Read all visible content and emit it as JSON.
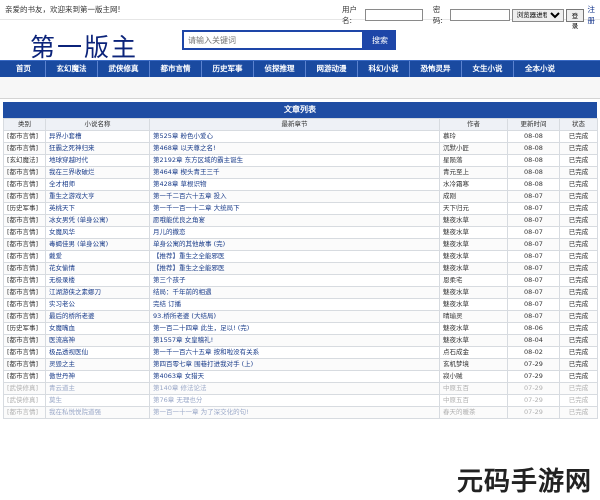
{
  "topbar": {
    "welcome": "亲爱的书友，欢迎来到第一版主网!",
    "username_label": "用户名:",
    "password_label": "密码:",
    "remember_option": "浏览器进程",
    "login_button": "登录",
    "register_link": "注册"
  },
  "header": {
    "logo": "第一版主",
    "search_placeholder": "请输入关键词",
    "search_button": "搜索"
  },
  "nav": {
    "items": [
      "首页",
      "玄幻魔法",
      "武侠修真",
      "都市言情",
      "历史军事",
      "侦探推理",
      "网游动漫",
      "科幻小说",
      "恐怖灵异",
      "女生小说",
      "全本小说"
    ]
  },
  "list": {
    "title": "文章列表",
    "columns": [
      "类别",
      "小说名称",
      "最新章节",
      "作者",
      "更新时间",
      "状态"
    ],
    "rows": [
      {
        "cat": "[都市言情]",
        "book": "异界小套槽",
        "chapter": "第525章 粉色小爱心",
        "author": "慕玲",
        "time": "08-08",
        "status": "已完成"
      },
      {
        "cat": "[都市言情]",
        "book": "狂霸之死神归来",
        "chapter": "第468章 以天尊之名!",
        "author": "沉默小匠",
        "time": "08-08",
        "status": "已完成"
      },
      {
        "cat": "[玄幻魔法]",
        "book": "地球穿越时代",
        "chapter": "第2192章 东方区域的霸主诞生",
        "author": "星陨落",
        "time": "08-08",
        "status": "已完成"
      },
      {
        "cat": "[都市言情]",
        "book": "我在三界收破烂",
        "chapter": "第464章 楔头青王三千",
        "author": "青元至上",
        "time": "08-08",
        "status": "已完成"
      },
      {
        "cat": "[都市言情]",
        "book": "全才相师",
        "chapter": "第428章 草根识物",
        "author": "水冷霜寒",
        "time": "08-08",
        "status": "已完成"
      },
      {
        "cat": "[都市言情]",
        "book": "重生之游戏大亨",
        "chapter": "第一千二百六十五章 投入",
        "author": "成刚",
        "time": "08-07",
        "status": "已完成"
      },
      {
        "cat": "[历史军事]",
        "book": "英桃天下",
        "chapter": "第一千一百一十二章 大统局下",
        "author": "天下归元",
        "time": "08-07",
        "status": "已完成"
      },
      {
        "cat": "[都市言情]",
        "book": "冰女男凭 (单身公寓)",
        "chapter": "愿哦能优良之角宴",
        "author": "魅夜水草",
        "time": "08-07",
        "status": "已完成"
      },
      {
        "cat": "[都市言情]",
        "book": "女魔风华",
        "chapter": "月儿的撒恋",
        "author": "魅夜水草",
        "time": "08-07",
        "status": "已完成"
      },
      {
        "cat": "[都市言情]",
        "book": "毒蝎佳男 (单身公寓)",
        "chapter": "单身公寓的其他故事 (完)",
        "author": "魅夜水草",
        "time": "08-07",
        "status": "已完成"
      },
      {
        "cat": "[都市言情]",
        "book": "戴爱",
        "chapter": "【推荐】重生之全能邪医",
        "author": "魅夜水草",
        "time": "08-07",
        "status": "已完成"
      },
      {
        "cat": "[都市言情]",
        "book": "花女偷情",
        "chapter": "【推荐】重生之全能邪医",
        "author": "魅夜水草",
        "time": "08-07",
        "status": "已完成"
      },
      {
        "cat": "[都市言情]",
        "book": "无极录楼",
        "chapter": "第三个孩子",
        "author": "恩柔宅",
        "time": "08-07",
        "status": "已完成"
      },
      {
        "cat": "[都市言情]",
        "book": "江湖游侠之素娜刀",
        "chapter": "结局：千年前的相遇",
        "author": "魅夜水草",
        "time": "08-07",
        "status": "已完成"
      },
      {
        "cat": "[都市言情]",
        "book": "实习老公",
        "chapter": "完结 订播",
        "author": "魅夜水草",
        "time": "08-07",
        "status": "已完成"
      },
      {
        "cat": "[都市言情]",
        "book": "最后的桥所老婆",
        "chapter": "93.桥所老婆 (大结局)",
        "author": "晴瑜灵",
        "time": "08-07",
        "status": "已完成"
      },
      {
        "cat": "[历史军事]",
        "book": "女魔嘴血",
        "chapter": "第一百二十四章 此生，足以! (完)",
        "author": "魅夜水草",
        "time": "08-06",
        "status": "已完成"
      },
      {
        "cat": "[都市言情]",
        "book": "医流高神",
        "chapter": "第1557章 女皇稽礼!",
        "author": "魅夜水草",
        "time": "08-04",
        "status": "已完成"
      },
      {
        "cat": "[都市言情]",
        "book": "极品透视医仙",
        "chapter": "第一千一百六十五章 按和啦没有关系",
        "author": "点石成金",
        "time": "08-02",
        "status": "已完成"
      },
      {
        "cat": "[都市言情]",
        "book": "灵毁之主",
        "chapter": "第四百零七章 围巷打进我对手 (上)",
        "author": "玄机梦境",
        "time": "07-29",
        "status": "已完成"
      },
      {
        "cat": "[都市言情]",
        "book": "傲世丹神",
        "chapter": "第4063章 女猎天",
        "author": "寂小贼",
        "time": "07-29",
        "status": "已完成"
      },
      {
        "cat": "[武侠修真]",
        "book": "青云道主",
        "chapter": "第140章 修法论法",
        "author": "中原五百",
        "time": "07-29",
        "status": "已完成"
      },
      {
        "cat": "[武侠修真]",
        "book": "莫生",
        "chapter": "第76章 无理也分",
        "author": "中原五百",
        "time": "07-29",
        "status": "已完成"
      },
      {
        "cat": "[都市言情]",
        "book": "我在私悦悦院道强",
        "chapter": "第一百一十一章 为了深交化的句!",
        "author": "春天的暖茶",
        "time": "07-29",
        "status": "已完成"
      }
    ]
  },
  "watermark": "元码手游网"
}
